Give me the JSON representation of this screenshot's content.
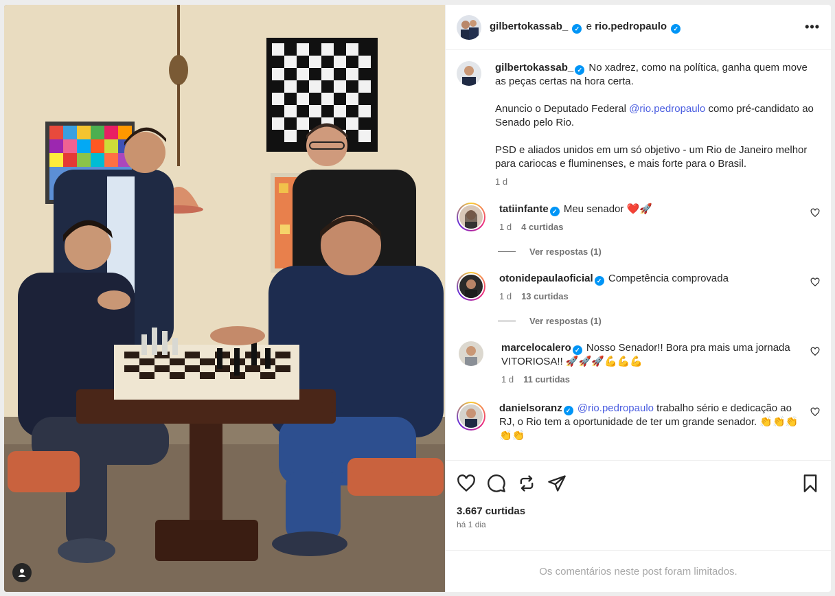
{
  "header": {
    "user1": "gilbertokassab_",
    "joiner": "e",
    "user2": "rio.pedropaulo",
    "more_label": "•••"
  },
  "caption": {
    "username": "gilbertokassab_",
    "line1": "No xadrez, como na política, ganha quem move as peças certas na hora certa.",
    "p2_before": "Anuncio o Deputado Federal ",
    "p2_mention": "@rio.pedropaulo",
    "p2_after": " como pré-candidato ao Senado pelo Rio.",
    "p3": "PSD e aliados unidos em um só objetivo - um Rio de Janeiro melhor para cariocas e fluminenses, e mais forte para o Brasil.",
    "time": "1 d"
  },
  "comments": [
    {
      "username": "tatiinfante",
      "text": "Meu senador ❤️🚀",
      "time": "1 d",
      "likes": "4 curtidas",
      "replies": "Ver respostas (1)"
    },
    {
      "username": "otonidepaulaoficial",
      "text": "Competência comprovada",
      "time": "1 d",
      "likes": "13 curtidas",
      "replies": "Ver respostas (1)"
    },
    {
      "username": "marcelocalero",
      "text": "Nosso Senador!! Bora pra mais uma jornada VITORIOSA!! 🚀🚀🚀💪💪💪",
      "time": "1 d",
      "likes": "11 curtidas"
    },
    {
      "username": "danielsoranz",
      "mention": "@rio.pedropaulo",
      "text": " trabalho sério e dedicação ao RJ, o Rio tem a oportunidade de ter um grande senador. 👏👏👏👏👏"
    }
  ],
  "post": {
    "likes": "3.667 curtidas",
    "time": "há 1 dia",
    "limited": "Os comentários neste post foram limitados."
  },
  "icons": {
    "like": "heart-icon",
    "comment": "comment-icon",
    "repost": "repost-icon",
    "share": "send-icon",
    "save": "bookmark-icon",
    "tag": "user-tag-icon"
  },
  "colors": {
    "verified": "#0095f6",
    "mention": "#4a5de0",
    "muted": "#737373"
  }
}
